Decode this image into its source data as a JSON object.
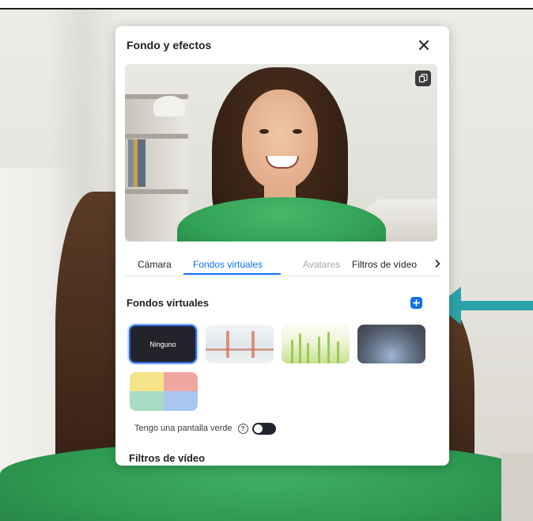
{
  "panel": {
    "title": "Fondo y efectos"
  },
  "icons": {
    "close": "close-icon",
    "copy": "copy-icon",
    "add": "plus-icon",
    "next": "chevron-right-icon",
    "help": "help-icon",
    "arrow": "arrow-left-icon"
  },
  "tabs": [
    {
      "label": "Cámara",
      "state": "default"
    },
    {
      "label": "Fondos virtuales",
      "state": "active"
    },
    {
      "label": "Avatares",
      "state": "disabled"
    },
    {
      "label": "Filtros de vídeo",
      "state": "default"
    }
  ],
  "virtual_backgrounds": {
    "title": "Fondos virtuales",
    "items": [
      {
        "label": "Ninguno",
        "selected": true
      },
      {
        "label": "",
        "image": "golden-gate-bridge"
      },
      {
        "label": "",
        "image": "grass"
      },
      {
        "label": "",
        "image": "earth-from-space"
      },
      {
        "label": "",
        "image": "colorful-pattern"
      }
    ]
  },
  "green_screen": {
    "label": "Tengo una pantalla verde",
    "enabled": false
  },
  "video_filters": {
    "title": "Filtros de vídeo"
  },
  "colors": {
    "accent": "#0e72ed",
    "annotation_arrow": "#2aa3a8",
    "toggle_off": "#21242c"
  }
}
